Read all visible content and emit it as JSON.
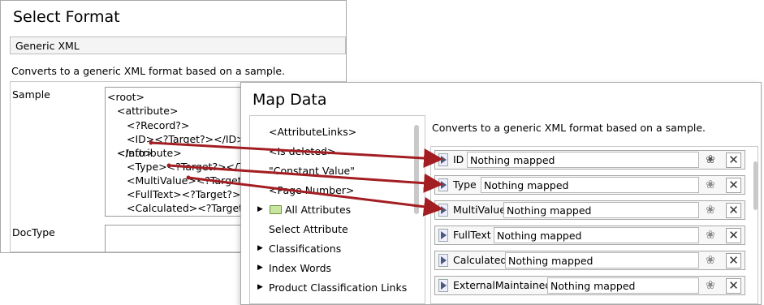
{
  "select_format": {
    "title": "Select Format",
    "format_value": "Generic XML",
    "description": "Converts to a generic XML format based on a sample.",
    "sample_label": "Sample",
    "doctype_label": "DocType",
    "sample_lines": [
      "<root>",
      "<attribute>",
      "<?Record?>",
      "<ID><?Target?></ID>",
      "</attribute>",
      "<Info>",
      "<Type><?Target?></Type>",
      "<MultiValue><?Target?></MultiValue>",
      "<FullText><?Target?></FullText>",
      "<Calculated><?Target?></Calculated>"
    ]
  },
  "map_data": {
    "title": "Map Data",
    "description": "Converts to a generic XML format based on a sample.",
    "source_items": [
      "<AttributeLinks>",
      "<Is deleted>",
      "\"Constant Value\"",
      "<Page Number>",
      "All Attributes",
      "Select Attribute",
      "Classifications",
      "Index Words",
      "Product Classification Links"
    ],
    "targets": [
      {
        "field": "ID",
        "value": "Nothing mapped"
      },
      {
        "field": "Type",
        "value": "Nothing mapped"
      },
      {
        "field": "MultiValue",
        "value": "Nothing mapped"
      },
      {
        "field": "FullText",
        "value": "Nothing mapped"
      },
      {
        "field": "Calculated",
        "value": "Nothing mapped"
      },
      {
        "field": "ExternalMaintained",
        "value": "Nothing mapped"
      }
    ],
    "icons": {
      "expand": "play-triangle-icon",
      "link": "link-icon",
      "remove": "close-icon",
      "folder": "folder-icon"
    }
  },
  "colors": {
    "arrow": "#a31e22",
    "folder": "#c8e6a0"
  }
}
